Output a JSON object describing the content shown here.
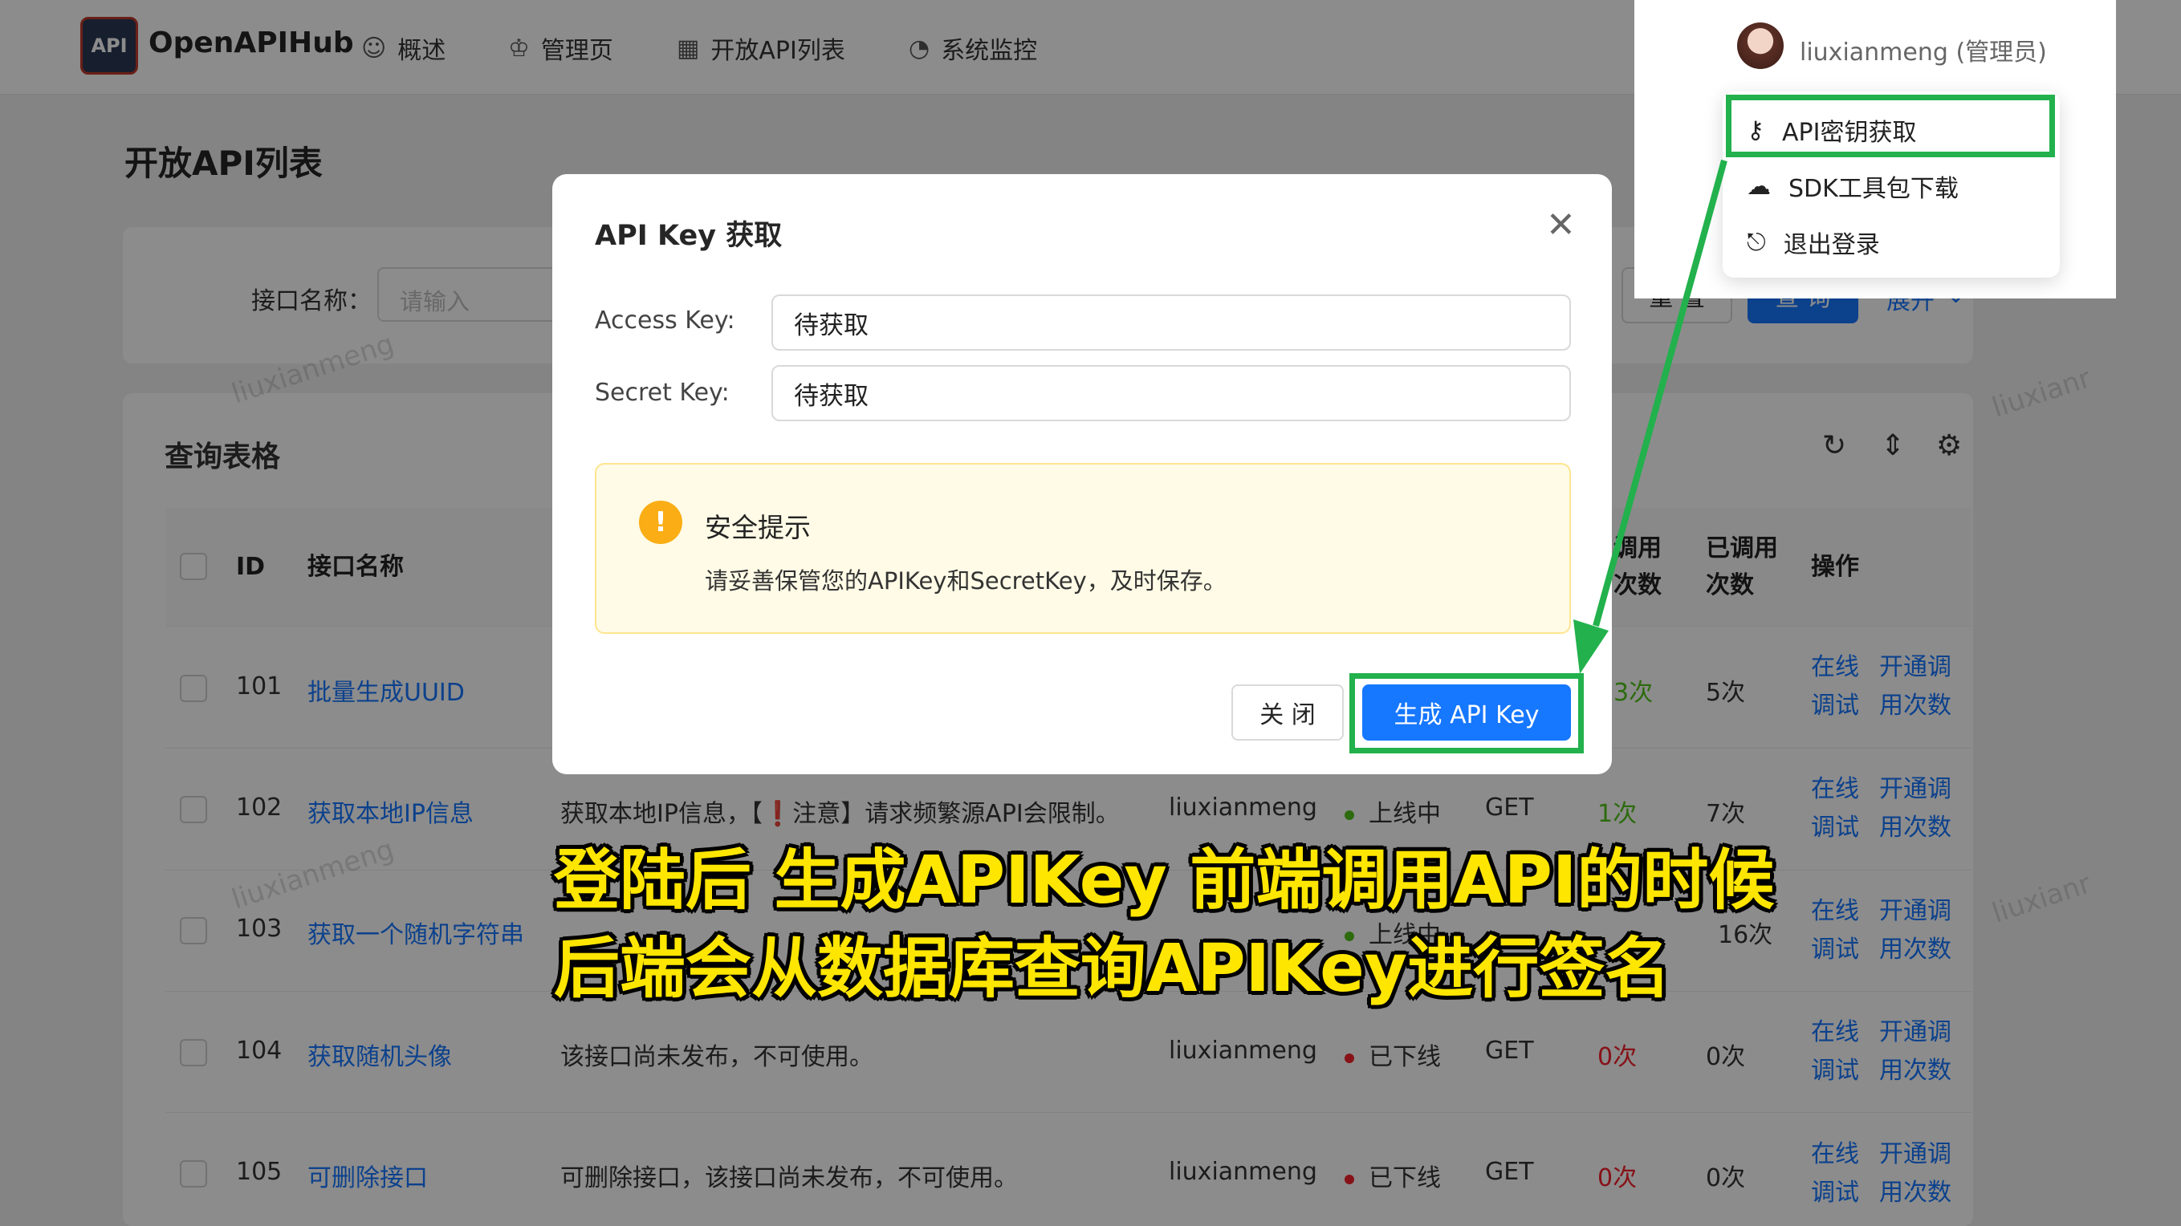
{
  "app": {
    "logo_text": "API",
    "title": "OpenAPIHub"
  },
  "nav": [
    {
      "label": "概述",
      "icon": "smile-icon"
    },
    {
      "label": "管理页",
      "icon": "crown-icon"
    },
    {
      "label": "开放API列表",
      "icon": "table-icon"
    },
    {
      "label": "系统监控",
      "icon": "dashboard-icon"
    }
  ],
  "page": {
    "title": "开放API列表"
  },
  "search": {
    "label": "接口名称：",
    "placeholder": "请输入",
    "reset": "重 置",
    "query": "查 询",
    "expand": "展开"
  },
  "table": {
    "title": "查询表格",
    "headers": {
      "id": "ID",
      "name": "接口名称",
      "total_1": "调用",
      "total_2": "次数",
      "used_1": "已调用",
      "used_2": "次数",
      "ops": "操作"
    },
    "rows": [
      {
        "id": "101",
        "name": "批量生成UUID",
        "desc": "",
        "creator": "",
        "status": "",
        "method": "",
        "total": "3次",
        "used": "5次"
      },
      {
        "id": "102",
        "name": "获取本地IP信息",
        "desc": "获取本地IP信息，【❗注意】请求频繁源API会限制。",
        "creator": "liuxianmeng",
        "status": "上线中",
        "method": "GET",
        "total": "1次",
        "used": "7次"
      },
      {
        "id": "103",
        "name": "获取一个随机字符串",
        "desc": "",
        "creator": "",
        "status": "上线中",
        "method": "",
        "total": "",
        "used": "16次"
      },
      {
        "id": "104",
        "name": "获取随机头像",
        "desc": "该接口尚未发布，不可使用。",
        "creator": "liuxianmeng",
        "status": "已下线",
        "method": "GET",
        "total": "0次",
        "used": "0次"
      },
      {
        "id": "105",
        "name": "可删除接口",
        "desc": "可删除接口，该接口尚未发布，不可使用。",
        "creator": "liuxianmeng",
        "status": "已下线",
        "method": "GET",
        "total": "0次",
        "used": "0次"
      }
    ],
    "ops": {
      "a1": "在线",
      "a2": "调试",
      "b1": "开通调",
      "b2": "用次数"
    }
  },
  "watermark": "liuxianmeng",
  "watermark_cut": "liuxianr",
  "modal": {
    "title": "API Key 获取",
    "access_label": "Access Key:",
    "access_value": "待获取",
    "secret_label": "Secret Key:",
    "secret_value": "待获取",
    "alert_title": "安全提示",
    "alert_text": "请妥善保管您的APIKey和SecretKey，及时保存。",
    "close": "关 闭",
    "generate": "生成 API Key"
  },
  "user": {
    "name": "liuxianmeng (管理员)",
    "menu": [
      {
        "label": "API密钥获取",
        "icon": "key-icon"
      },
      {
        "label": "SDK工具包下载",
        "icon": "cloud-download-icon"
      },
      {
        "label": "退出登录",
        "icon": "logout-icon"
      }
    ]
  },
  "caption": {
    "line1": "登陆后 生成APIKey 前端调用API的时候",
    "line2": "后端会从数据库查询APIKey进行签名"
  },
  "colors": {
    "primary": "#1677ff",
    "highlight": "#22b14c",
    "caption": "#ffe600",
    "online": "#52c41a",
    "offline": "#f5222d"
  }
}
